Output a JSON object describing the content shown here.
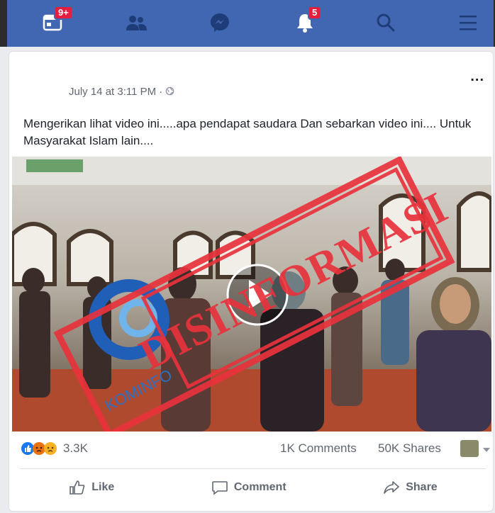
{
  "nav": {
    "home_badge": "9+",
    "notif_badge": "5"
  },
  "post": {
    "timestamp": "July 14 at 3:11 PM · ",
    "more_label": "...",
    "text": "Mengerikan lihat video ini.....apa pendapat saudara Dan sebarkan video ini.... Untuk Masyarakat Islam lain....",
    "stamp_text": "DISINFORMASI",
    "logo_text": "KOMINFO"
  },
  "stats": {
    "reactions": "3.3K",
    "comments": "1K Comments",
    "shares": "50K Shares"
  },
  "actions": {
    "like": "Like",
    "comment": "Comment",
    "share": "Share"
  },
  "colors": {
    "brand": "#4267b2",
    "badge": "#e41e3f",
    "stamp": "#e8323c"
  }
}
